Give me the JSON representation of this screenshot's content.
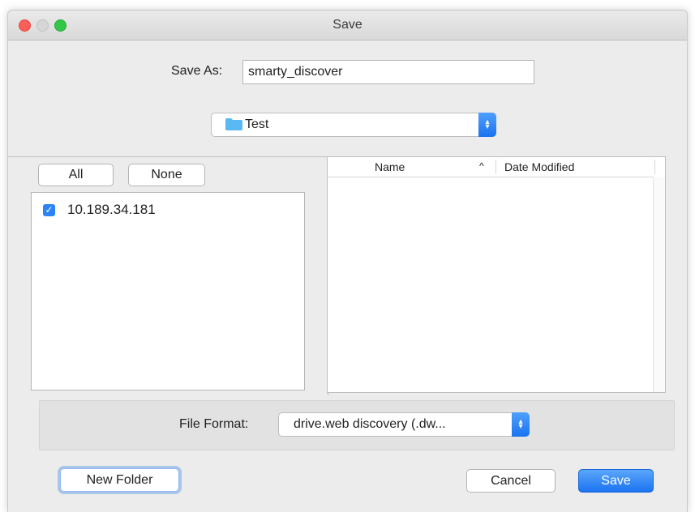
{
  "window": {
    "title": "Save"
  },
  "save_as": {
    "label": "Save As:",
    "value": "smarty_discover"
  },
  "location": {
    "folder": "Test"
  },
  "selection": {
    "all_label": "All",
    "none_label": "None"
  },
  "devices": [
    {
      "label": "10.189.34.181",
      "checked": true
    }
  ],
  "file_list": {
    "columns": [
      {
        "label": "Name",
        "sort_indicator": "^"
      },
      {
        "label": "Date Modified"
      }
    ],
    "rows": []
  },
  "file_format": {
    "label": "File Format:",
    "value": "drive.web discovery (.dw..."
  },
  "footer": {
    "new_folder_label": "New Folder",
    "cancel_label": "Cancel",
    "save_label": "Save"
  },
  "colors": {
    "accent": "#1a73f0",
    "folder": "#5ab8f5",
    "close": "#fc5f57",
    "maximize": "#33c748"
  }
}
